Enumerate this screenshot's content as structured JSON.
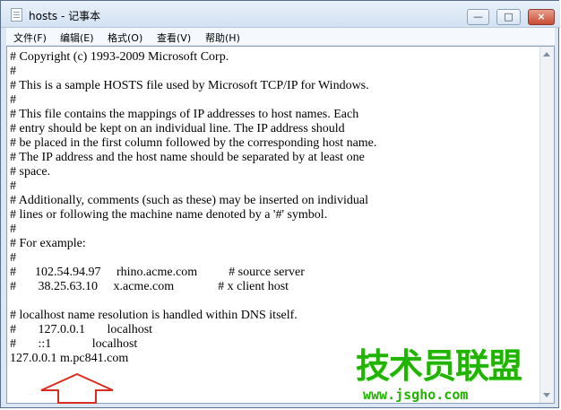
{
  "window": {
    "title": "hosts - 记事本",
    "buttons": {
      "minimize": "—",
      "maximize": "□",
      "close": "×"
    }
  },
  "menu": {
    "items": [
      "文件(F)",
      "编辑(E)",
      "格式(O)",
      "查看(V)",
      "帮助(H)"
    ]
  },
  "editor": {
    "lines": [
      "# Copyright (c) 1993-2009 Microsoft Corp.",
      "#",
      "# This is a sample HOSTS file used by Microsoft TCP/IP for Windows.",
      "#",
      "# This file contains the mappings of IP addresses to host names. Each",
      "# entry should be kept on an individual line. The IP address should",
      "# be placed in the first column followed by the corresponding host name.",
      "# The IP address and the host name should be separated by at least one",
      "# space.",
      "#",
      "# Additionally, comments (such as these) may be inserted on individual",
      "# lines or following the machine name denoted by a '#' symbol.",
      "#",
      "# For example:",
      "#",
      "#      102.54.94.97     rhino.acme.com          # source server",
      "#       38.25.63.10     x.acme.com              # x client host",
      "",
      "# localhost name resolution is handled within DNS itself.",
      "#       127.0.0.1       localhost",
      "#       ::1             localhost",
      "127.0.0.1 m.pc841.com"
    ]
  },
  "watermark": {
    "title": "技术员联盟",
    "url": "www.jsgho.com"
  },
  "colors": {
    "watermark_green": "#20b400",
    "arrow_red": "#d92d1f",
    "title_bar": "#dbe7f4"
  },
  "icons": {
    "notepad": "notepad-icon",
    "annotation_arrow": "up-arrow-icon"
  }
}
